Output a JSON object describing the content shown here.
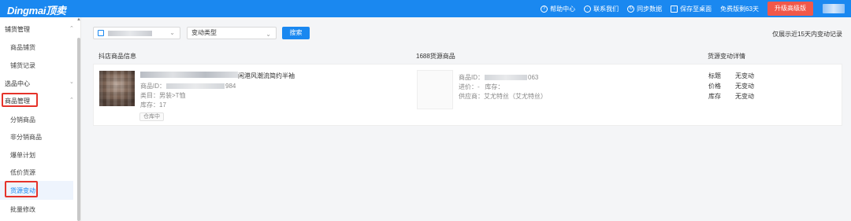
{
  "app": {
    "logo": "Dingmai顶卖"
  },
  "topbar": {
    "help": "帮助中心",
    "contact": "联系我们",
    "sync": "同步数据",
    "save_desktop": "保存至桌面",
    "trial": "免费版剩63天",
    "upgrade": "升级高级版"
  },
  "sidebar": {
    "groups": [
      {
        "label": "铺货管理",
        "items": [
          "商品铺货",
          "铺货记录"
        ]
      },
      {
        "label": "选品中心",
        "items": []
      },
      {
        "label": "商品管理",
        "items": [
          "分销商品",
          "非分销商品",
          "爆单计划",
          "低价货源",
          "货源变动",
          "批量修改"
        ]
      }
    ],
    "active_item": "货源变动"
  },
  "filters": {
    "change_type_placeholder": "变动类型",
    "search_label": "搜索",
    "notice": "仅展示近15天内变动记录"
  },
  "table": {
    "headers": [
      "抖店商品信息",
      "1688货源商品",
      "货源变动详情"
    ],
    "rows": [
      {
        "title_suffix": "闲港风潮流简约半袖",
        "id_label": "商品ID：",
        "id_suffix": "984",
        "category": "类目：男装>T恤",
        "stock": "库存：17",
        "tag": "仓库中",
        "source": {
          "id_label": "商品ID：",
          "id_suffix": "063",
          "price": "进价：-",
          "stock": "库存：",
          "supplier": "供应商：艾尤特丝（艾尤特丝）"
        },
        "changes": [
          {
            "field": "标题",
            "value": "无变动"
          },
          {
            "field": "价格",
            "value": "无变动"
          },
          {
            "field": "库存",
            "value": "无变动"
          }
        ]
      }
    ]
  },
  "colors": {
    "primary": "#1a88f0",
    "upgrade": "#f1584a",
    "highlight": "#e5332a"
  }
}
